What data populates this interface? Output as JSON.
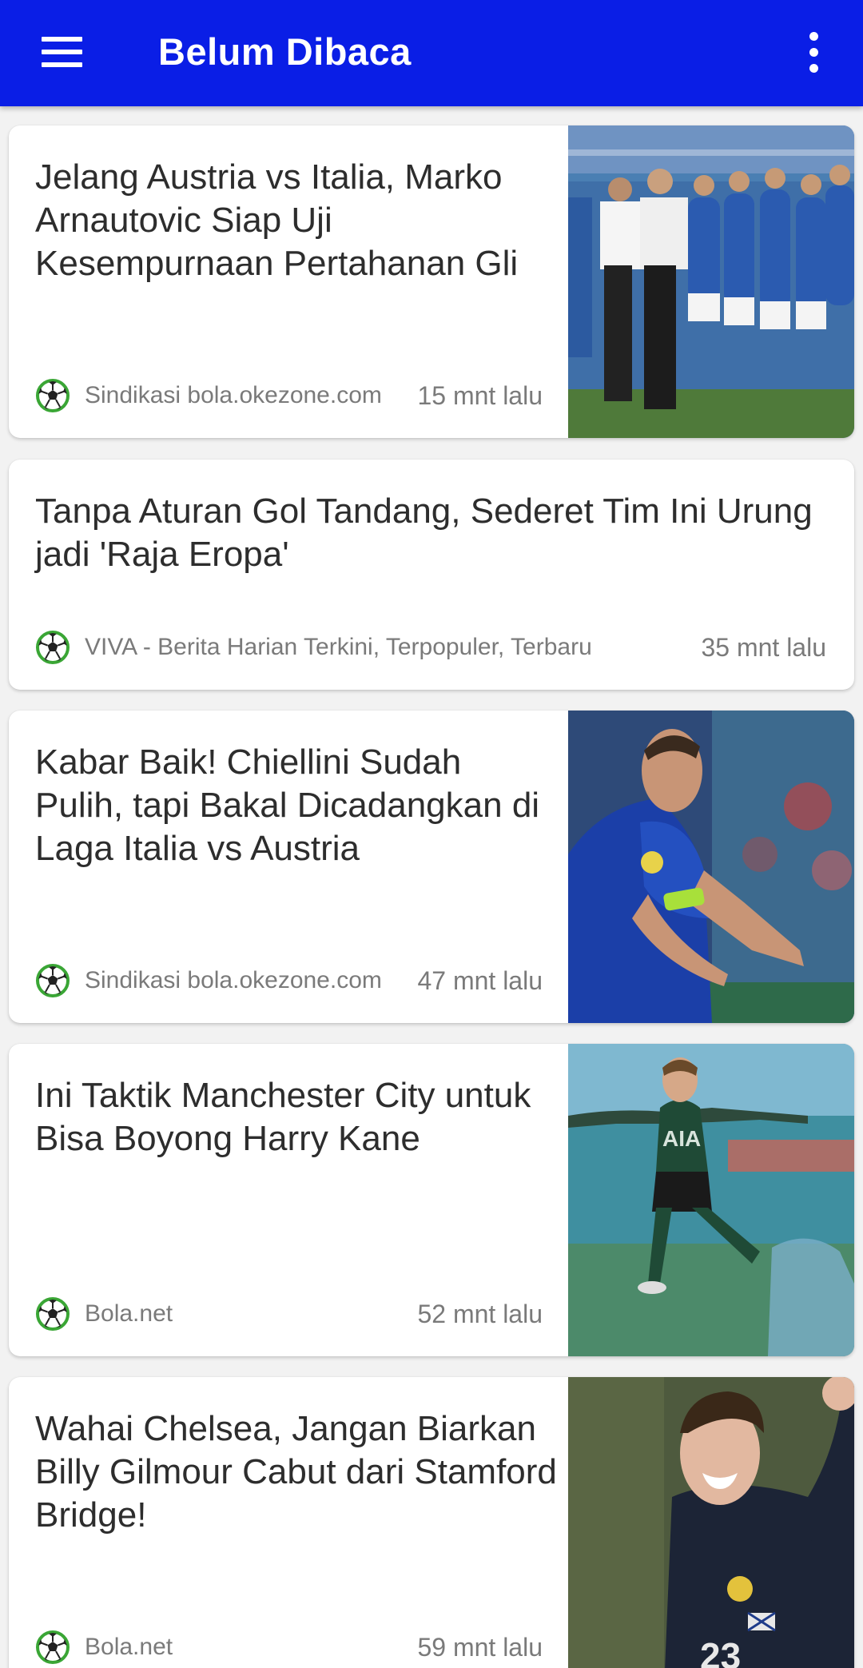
{
  "appbar": {
    "title": "Belum Dibaca",
    "color": "#0a1ee6",
    "menu_icon": "hamburger-menu-icon",
    "overflow_icon": "more-vert-icon"
  },
  "articles": [
    {
      "title": "Jelang Austria vs Italia, Marko Arnautovic Siap Uji Kesempurnaan Pertahanan Gli",
      "source": "Sindikasi bola.okezone.com",
      "time": "15 mnt lalu",
      "source_icon": "soccer-ball-icon",
      "has_image": true
    },
    {
      "title": "Tanpa Aturan Gol Tandang, Sederet Tim Ini Urung jadi 'Raja Eropa'",
      "source": "VIVA - Berita Harian Terkini, Terpopuler, Terbaru",
      "time": "35 mnt lalu",
      "source_icon": "soccer-ball-icon",
      "has_image": false
    },
    {
      "title": "Kabar Baik! Chiellini Sudah Pulih, tapi Bakal Dicadangkan di Laga Italia vs Austria",
      "source": "Sindikasi bola.okezone.com",
      "time": "47 mnt lalu",
      "source_icon": "soccer-ball-icon",
      "has_image": true
    },
    {
      "title": "Ini Taktik Manchester City untuk Bisa Boyong Harry Kane",
      "source": "Bola.net",
      "time": "52 mnt lalu",
      "source_icon": "soccer-ball-icon",
      "has_image": true
    },
    {
      "title": "Wahai Chelsea, Jangan Biarkan Billy Gilmour Cabut dari Stamford Bridge!",
      "source": "Bola.net",
      "time": "59 mnt lalu",
      "source_icon": "soccer-ball-icon",
      "has_image": true
    }
  ]
}
